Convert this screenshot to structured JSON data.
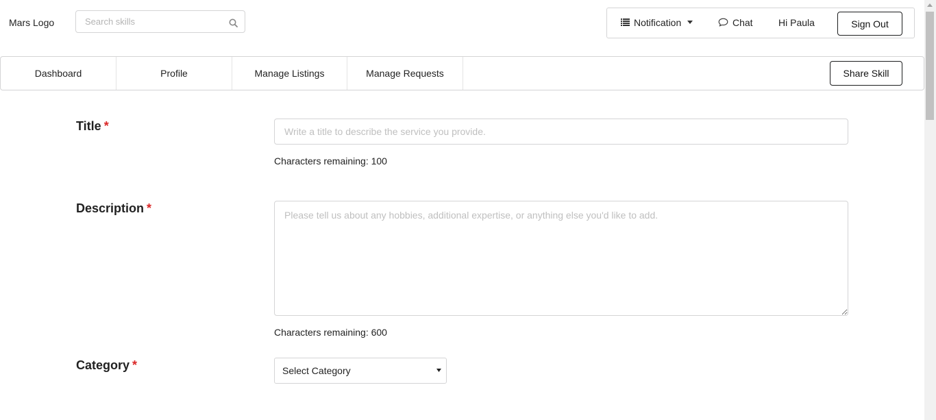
{
  "header": {
    "logo": "Mars Logo",
    "search": {
      "placeholder": "Search skills",
      "value": ""
    },
    "notification_label": "Notification",
    "chat_label": "Chat",
    "greeting": "Hi Paula",
    "signout_label": "Sign Out"
  },
  "nav": {
    "tabs": [
      {
        "label": "Dashboard"
      },
      {
        "label": "Profile"
      },
      {
        "label": "Manage Listings"
      },
      {
        "label": "Manage Requests"
      }
    ],
    "share_label": "Share Skill"
  },
  "form": {
    "title": {
      "label": "Title",
      "required_mark": "*",
      "placeholder": "Write a title to describe the service you provide.",
      "value": "",
      "counter": "Characters remaining: 100"
    },
    "description": {
      "label": "Description",
      "required_mark": "*",
      "placeholder": "Please tell us about any hobbies, additional expertise, or anything else you'd like to add.",
      "value": "",
      "counter": "Characters remaining: 600"
    },
    "category": {
      "label": "Category",
      "required_mark": "*",
      "selected": "Select Category"
    }
  },
  "icons": {
    "search": "search-icon",
    "notification": "list-icon",
    "notification_caret": "caret-down-icon",
    "chat": "chat-bubble-icon",
    "category_arrow": "caret-down-icon"
  },
  "colors": {
    "required": "#db2828",
    "border": "#d4d4d5",
    "placeholder": "#bfbfbf",
    "button_border": "#1b1c1d"
  }
}
